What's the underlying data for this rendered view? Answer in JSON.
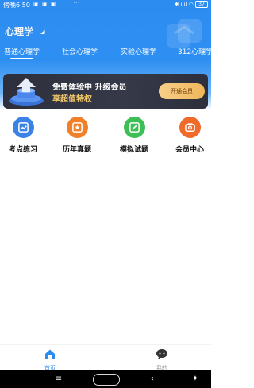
{
  "status": {
    "time": "傍晚6:50",
    "apps": "▣ ▣ ▣",
    "dots": "···",
    "right": "✱ ıııl ◠",
    "battery": "37"
  },
  "header": {
    "title": "心理学"
  },
  "tabs": [
    {
      "label": "普通心理学",
      "active": true
    },
    {
      "label": "社会心理学"
    },
    {
      "label": "实验心理学"
    },
    {
      "label": "312心理学"
    }
  ],
  "banner": {
    "line1": "免费体验中  升级会员",
    "line2": "享超值特权",
    "button": "开通会员"
  },
  "features": [
    {
      "label": "考点练习",
      "color": "#3b82e6",
      "icon": "chart-icon"
    },
    {
      "label": "历年真题",
      "color": "#f0812a",
      "icon": "star-icon"
    },
    {
      "label": "模拟试题",
      "color": "#3ebf55",
      "icon": "edit-icon"
    },
    {
      "label": "会员中心",
      "color": "#f06a2a",
      "icon": "camera-icon"
    }
  ],
  "bottom_nav": {
    "home": "首页",
    "me": "我的"
  },
  "system_nav": {
    "menu": "≡",
    "back": "‹",
    "assist": "✦"
  }
}
